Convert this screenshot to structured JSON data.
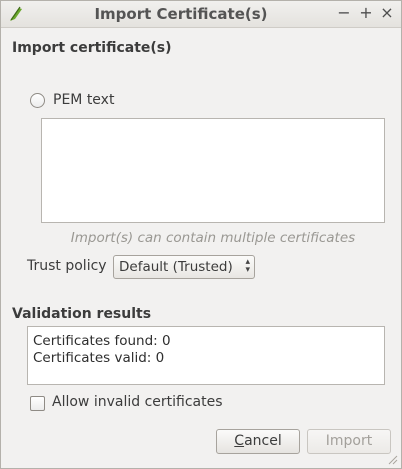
{
  "window": {
    "title": "Import Certificate(s)",
    "icon": "qgis-icon",
    "controls": {
      "minimize": "−",
      "maximize": "+",
      "close": "×"
    }
  },
  "import_section": {
    "heading": "Import certificate(s)",
    "pem_radio_label": "PEM text",
    "pem_radio_selected": false,
    "pem_text_value": "",
    "hint": "Import(s) can contain multiple certificates",
    "trust_policy_label": "Trust policy",
    "trust_policy_value": "Default (Trusted)"
  },
  "validation": {
    "heading": "Validation results",
    "lines": [
      "Certificates found: 0",
      "Certificates valid: 0"
    ],
    "allow_invalid_label": "Allow invalid certificates",
    "allow_invalid_checked": false
  },
  "buttons": {
    "cancel_mnemonic": "C",
    "cancel_rest": "ancel",
    "import": "Import",
    "import_enabled": false
  },
  "colors": {
    "background": "#f2f1f0",
    "hint_text": "#9a9893",
    "disabled_text": "#a3a09b",
    "icon_green": "#6aa72c"
  }
}
